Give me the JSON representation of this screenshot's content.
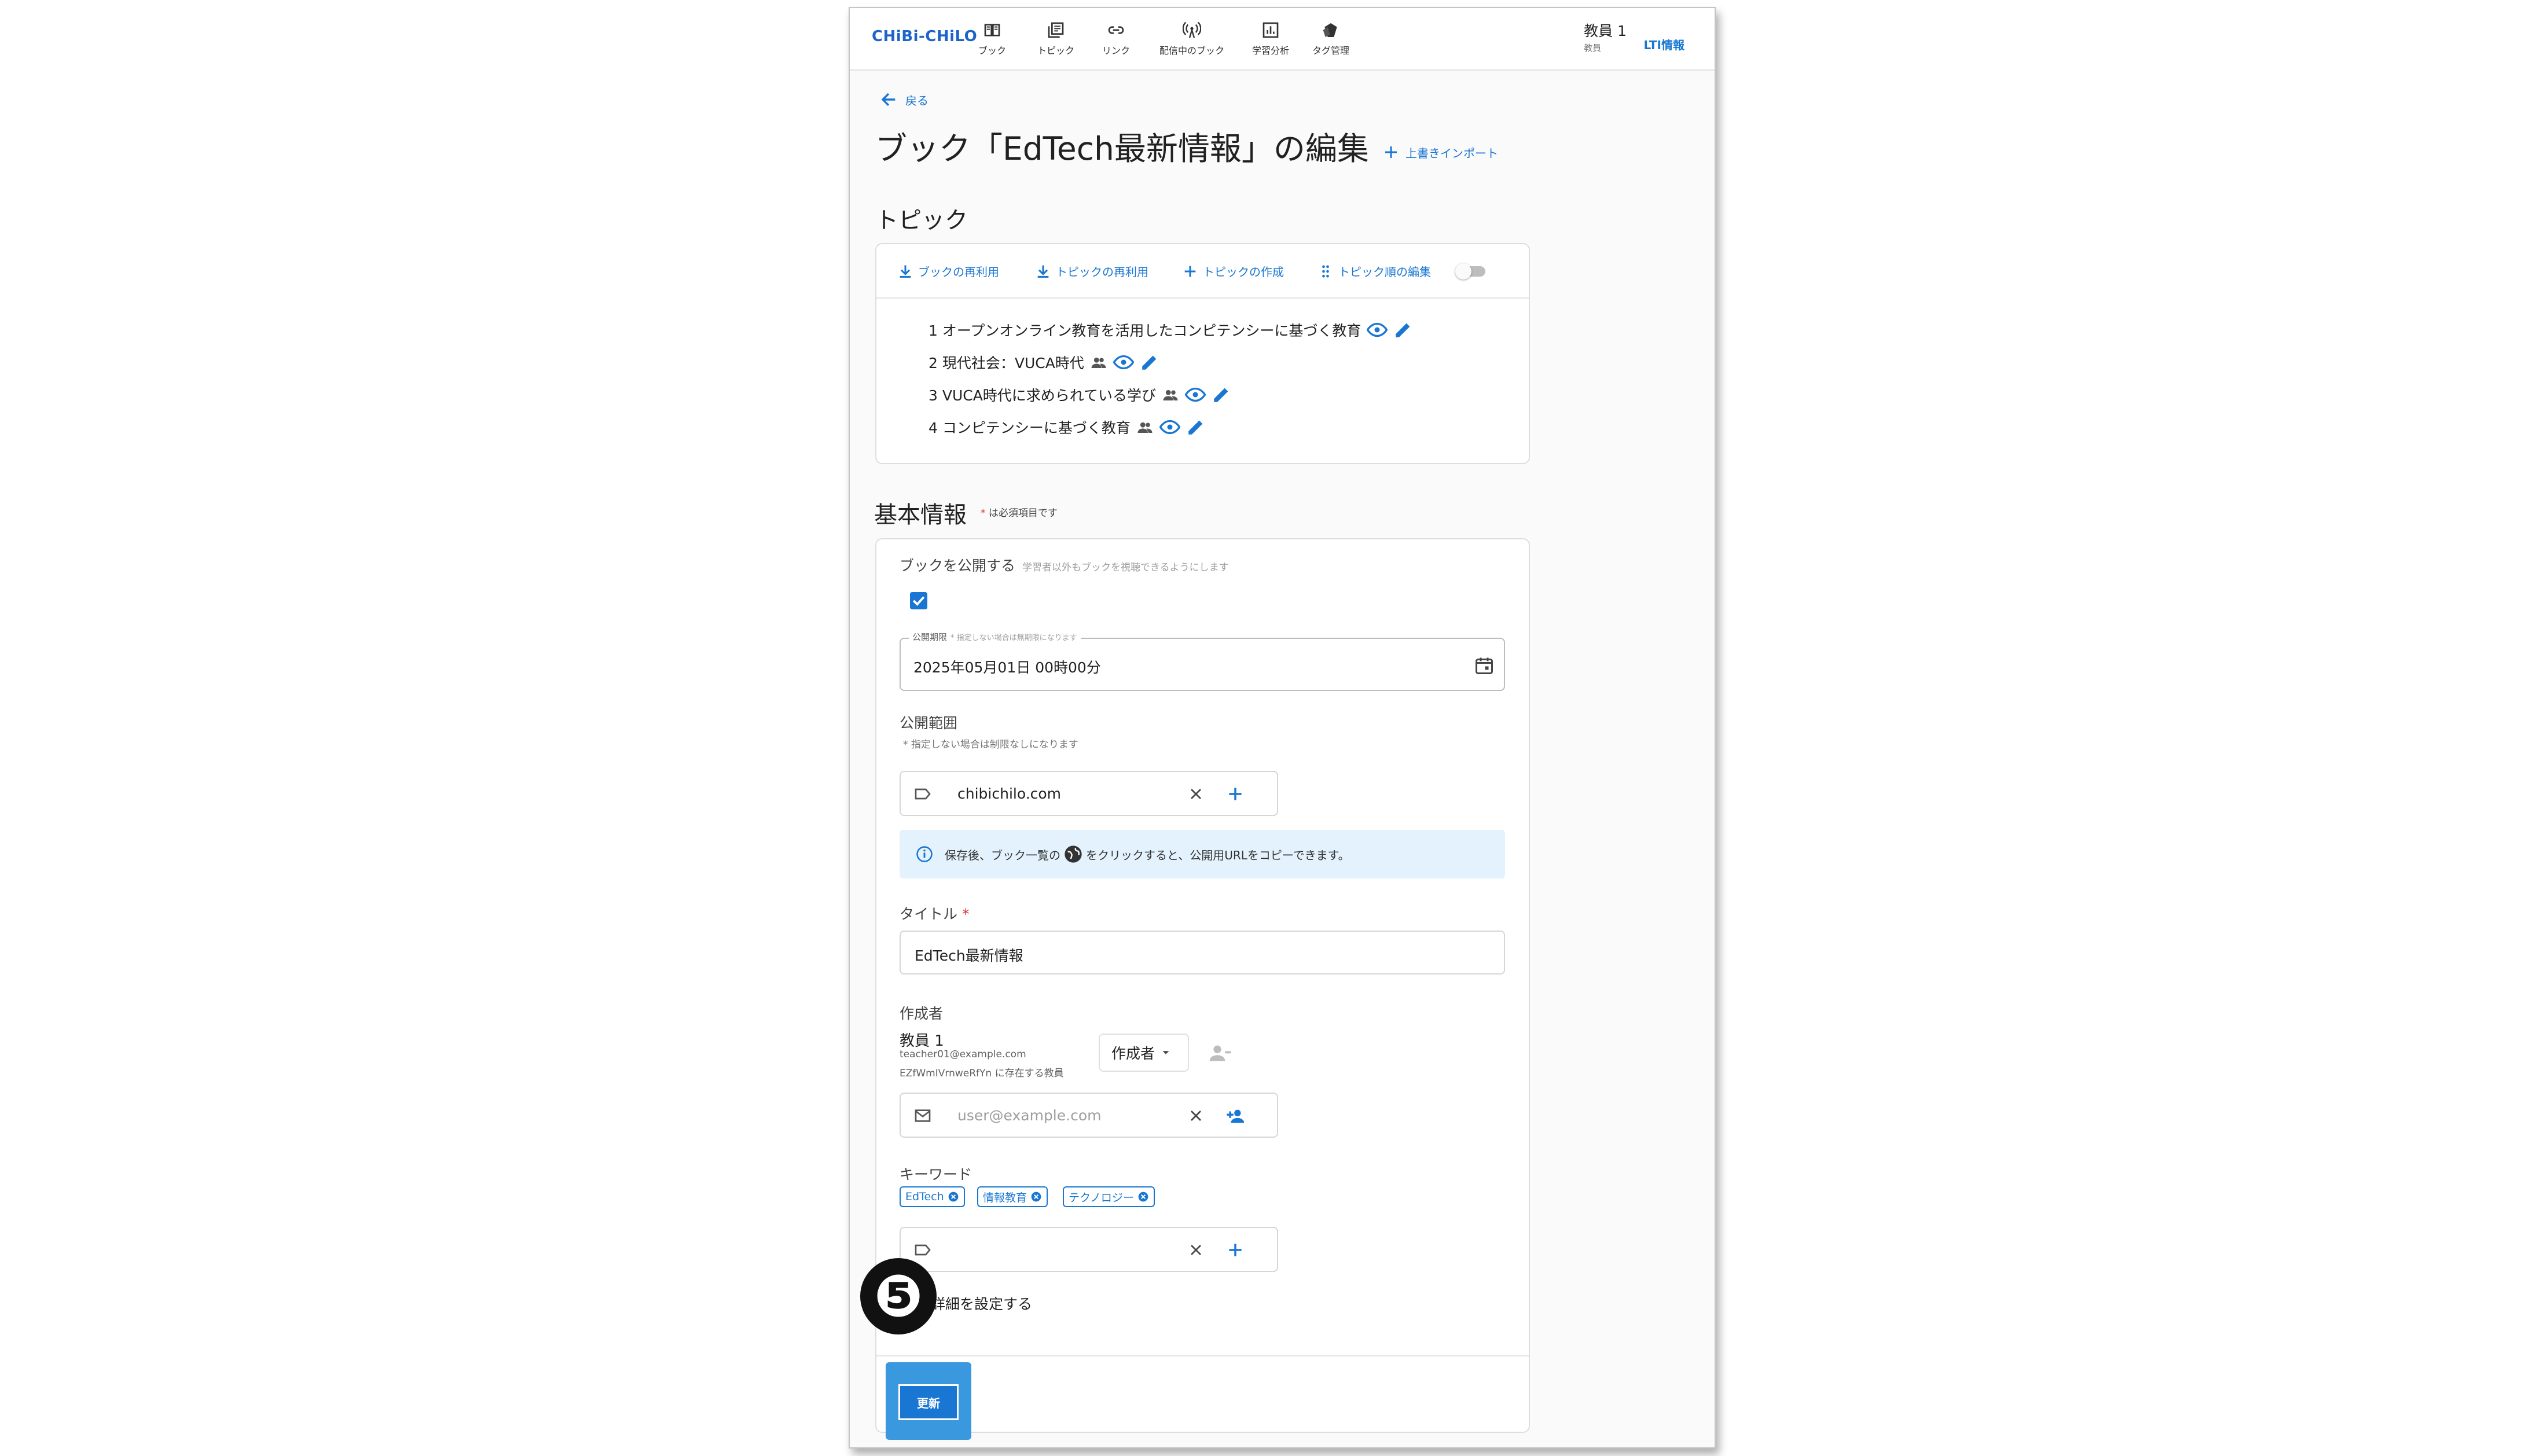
{
  "app": {
    "logo": "CHiBi-CHiLO"
  },
  "nav": [
    {
      "label": "ブック",
      "icon": "book-icon"
    },
    {
      "label": "トピック",
      "icon": "topic-icon"
    },
    {
      "label": "リンク",
      "icon": "link-icon"
    },
    {
      "label": "配信中のブック",
      "icon": "broadcast-icon"
    },
    {
      "label": "学習分析",
      "icon": "analytics-icon"
    },
    {
      "label": "タグ管理",
      "icon": "tag-icon"
    }
  ],
  "user": {
    "name": "教員 1",
    "role": "教員",
    "lti": "LTI情報"
  },
  "page": {
    "back": "戻る",
    "title": "ブック「EdTech最新情報」の編集",
    "import": "上書きインポート"
  },
  "topics": {
    "heading": "トピック",
    "toolbar": {
      "reuse_book": "ブックの再利用",
      "reuse_topic": "トピックの再利用",
      "create_topic": "トピックの作成",
      "edit_order": "トピック順の編集"
    },
    "items": [
      {
        "label": "1 オープンオンライン教育を活用したコンピテンシーに基づく教育",
        "shared": false
      },
      {
        "label": "2 現代社会：VUCA時代",
        "shared": true
      },
      {
        "label": "3 VUCA時代に求められている学び",
        "shared": true
      },
      {
        "label": "4 コンピテンシーに基づく教育",
        "shared": true
      }
    ]
  },
  "basic": {
    "heading": "基本情報",
    "required_note_mark": "*",
    "required_note": "は必須項目です",
    "publish_label": "ブックを公開する",
    "publish_hint": "学習者以外もブックを視聴できるようにします",
    "publish_checked": true,
    "period_label": "公開期限",
    "period_hint": "* 指定しない場合は無期限になります",
    "period_value": "2025年05月01日 00時00分",
    "scope_label": "公開範囲",
    "scope_hint": "* 指定しない場合は制限なしになります",
    "scope_value": "chibichilo.com",
    "alert_pre": "保存後、ブック一覧の",
    "alert_post": "をクリックすると、公開用URLをコピーできます。",
    "title_label": "タイトル",
    "title_required": "*",
    "title_value": "EdTech最新情報",
    "author_label": "作成者",
    "author_name": "教員 1",
    "author_email": "teacher01@example.com",
    "author_org": "EZfWmIVrnweRfYn に存在する教員",
    "author_role": "作成者",
    "author_input_placeholder": "user@example.com",
    "keywords_label": "キーワード",
    "keywords": [
      "EdTech",
      "情報教育",
      "テクノロジー"
    ],
    "advanced_label": "詳細を設定する",
    "update_button": "更新"
  },
  "annotation": {
    "badge": "❺"
  },
  "colors": {
    "accent": "#1976d2",
    "highlight": "#3a98de",
    "alert_bg": "#e3f2fd",
    "required": "#d32f2f"
  }
}
